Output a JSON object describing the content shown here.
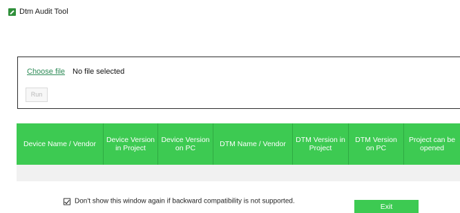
{
  "window": {
    "title": "Dtm Audit Tool",
    "icon": "dtm-app-icon"
  },
  "file": {
    "choose_label": "Choose file",
    "status": "No file selected",
    "run_label": "Run"
  },
  "grid": {
    "columns": [
      "Device Name / Vendor",
      "Device Version in Project",
      "Device Version on PC",
      "DTM Name / Vendor",
      "DTM Version in Project",
      "DTM Version on PC",
      "Project can be opened"
    ],
    "rows": []
  },
  "footer": {
    "checkbox_label": "Don't show this window again if backward compatibility is not supported.",
    "checkbox_checked": true,
    "exit_label": "Exit"
  },
  "colors": {
    "accent": "#3dca52",
    "link": "#2e8b57"
  }
}
